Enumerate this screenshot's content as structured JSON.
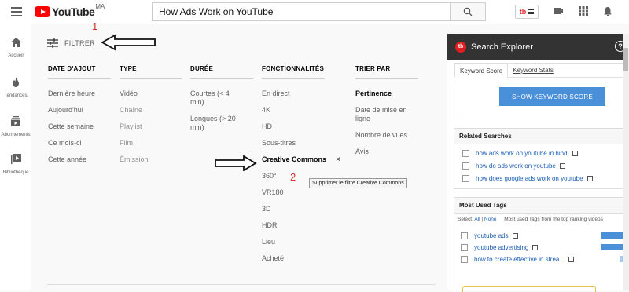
{
  "header": {
    "logo_text": "YouTube",
    "country_code": "MA",
    "search_value": "How Ads Work on YouTube",
    "tb_logo": "tb"
  },
  "nav": [
    {
      "label": "Accueil"
    },
    {
      "label": "Tendances"
    },
    {
      "label": "Abonnements"
    },
    {
      "label": "Bibliothèque"
    }
  ],
  "filter": {
    "label": "FILTRER",
    "annotation_1": "1",
    "annotation_2": "2",
    "columns": [
      {
        "heading": "DATE D'AJOUT",
        "items": [
          "Dernière heure",
          "Aujourd'hui",
          "Cette semaine",
          "Ce mois-ci",
          "Cette année"
        ]
      },
      {
        "heading": "TYPE",
        "items": [
          "Vidéo",
          "Chaîne",
          "Playlist",
          "Film",
          "Émission"
        ]
      },
      {
        "heading": "DURÉE",
        "items": [
          "Courtes (< 4 min)",
          "Longues (> 20 min)"
        ]
      },
      {
        "heading": "FONCTIONNALITÉS",
        "items": [
          "En direct",
          "4K",
          "HD",
          "Sous-titres",
          "Creative Commons",
          "360°",
          "VR180",
          "3D",
          "HDR",
          "Lieu",
          "Acheté"
        ]
      },
      {
        "heading": "TRIER PAR",
        "items": [
          "Pertinence",
          "Date de mise en ligne",
          "Nombre de vues",
          "Avis"
        ]
      }
    ],
    "remove_symbol": "×",
    "tooltip": "Supprimer le filtre Creative Commons"
  },
  "search_explorer": {
    "title": "Search Explorer",
    "help": "?",
    "tabs": [
      "Keyword Score",
      "Keyword Stats"
    ],
    "button": "SHOW KEYWORD SCORE",
    "related_title": "Related Searches",
    "related": [
      "how ads work on youtube in hindi",
      "how do ads work on youtube",
      "how does google ads work on youtube"
    ],
    "tags_title": "Most Used Tags",
    "select_label": "Select:",
    "select_all": "All",
    "select_sep": "|",
    "select_none": "None",
    "tags_subtitle": "Most used Tags from the top ranking videos",
    "tags": [
      {
        "label": "youtube ads",
        "count": "2"
      },
      {
        "label": "youtube advertising",
        "count": "2"
      },
      {
        "label": "how to create effective in strea...",
        "count": ""
      }
    ]
  },
  "colors": {
    "youtube_red": "#ff0000",
    "annotation_red": "#d32f2f",
    "link_blue": "#1a5db5",
    "button_blue": "#4a90d9"
  }
}
